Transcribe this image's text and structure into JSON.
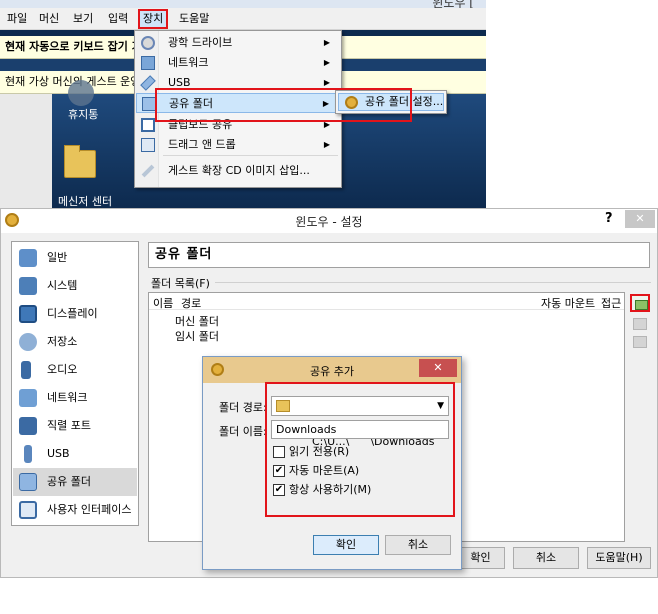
{
  "vm_window": {
    "title": "윈도우 [",
    "menu": [
      "파일",
      "머신",
      "보기",
      "입력",
      "장치",
      "도움말"
    ],
    "notice1": "현재 자동으로 키보드 잡기 기능이 활성화되어 있을 때 자동으로 키보드",
    "notice2": "현재 가상 머신의 게스트 운영 체제에서 마우스를 사",
    "desktop_icons": [
      "휴지통",
      "메신저 센터"
    ],
    "device_menu": [
      {
        "label": "광학 드라이브",
        "icon": "disc-icon",
        "submenu": true
      },
      {
        "label": "네트워크",
        "icon": "network-icon",
        "submenu": true
      },
      {
        "label": "USB",
        "icon": "usb-icon",
        "submenu": true
      },
      {
        "label": "공유 폴더",
        "icon": "shared-folder-icon",
        "submenu": true
      },
      {
        "label": "클립보드 공유",
        "icon": "clipboard-icon",
        "submenu": true
      },
      {
        "label": "드래그 앤 드롭",
        "icon": "drag-drop-icon",
        "submenu": true
      },
      {
        "label": "게스트 확장 CD 이미지 삽입...",
        "icon": "wrench-icon",
        "submenu": false
      }
    ],
    "submenu_item": "공유 폴더 설정..."
  },
  "settings": {
    "title": "윈도우 - 설정",
    "help": "?",
    "close": "✕",
    "sidebar": [
      "일반",
      "시스템",
      "디스플레이",
      "저장소",
      "오디오",
      "네트워크",
      "직렬 포트",
      "USB",
      "공유 폴더",
      "사용자 인터페이스"
    ],
    "selected": "공유 폴더",
    "pane_title": "공유 폴더",
    "folder_list_label": "폴더 목록(F)",
    "columns": {
      "name": "이름",
      "path": "경로",
      "automount": "자동 마운트",
      "access": "접근"
    },
    "rows": [
      "머신 폴더",
      "임시 폴더"
    ],
    "buttons": {
      "ok": "확인",
      "cancel": "취소",
      "help": "도움말(H)"
    }
  },
  "add_share": {
    "title": "공유 추가",
    "close": "✕",
    "path_label": "폴더 경로:",
    "path_value": "C:\\U...\\      \\Downloads",
    "name_label": "폴더 이름:",
    "name_value": "Downloads",
    "checks": [
      {
        "label": "읽기 전용(R)",
        "checked": false
      },
      {
        "label": "자동 마운트(A)",
        "checked": true
      },
      {
        "label": "항상 사용하기(M)",
        "checked": true
      }
    ],
    "ok": "확인",
    "cancel": "취소"
  },
  "colors": {
    "highlight": "#e2141a",
    "selection": "#cde6fb",
    "notice_bg": "#ffffe1"
  }
}
